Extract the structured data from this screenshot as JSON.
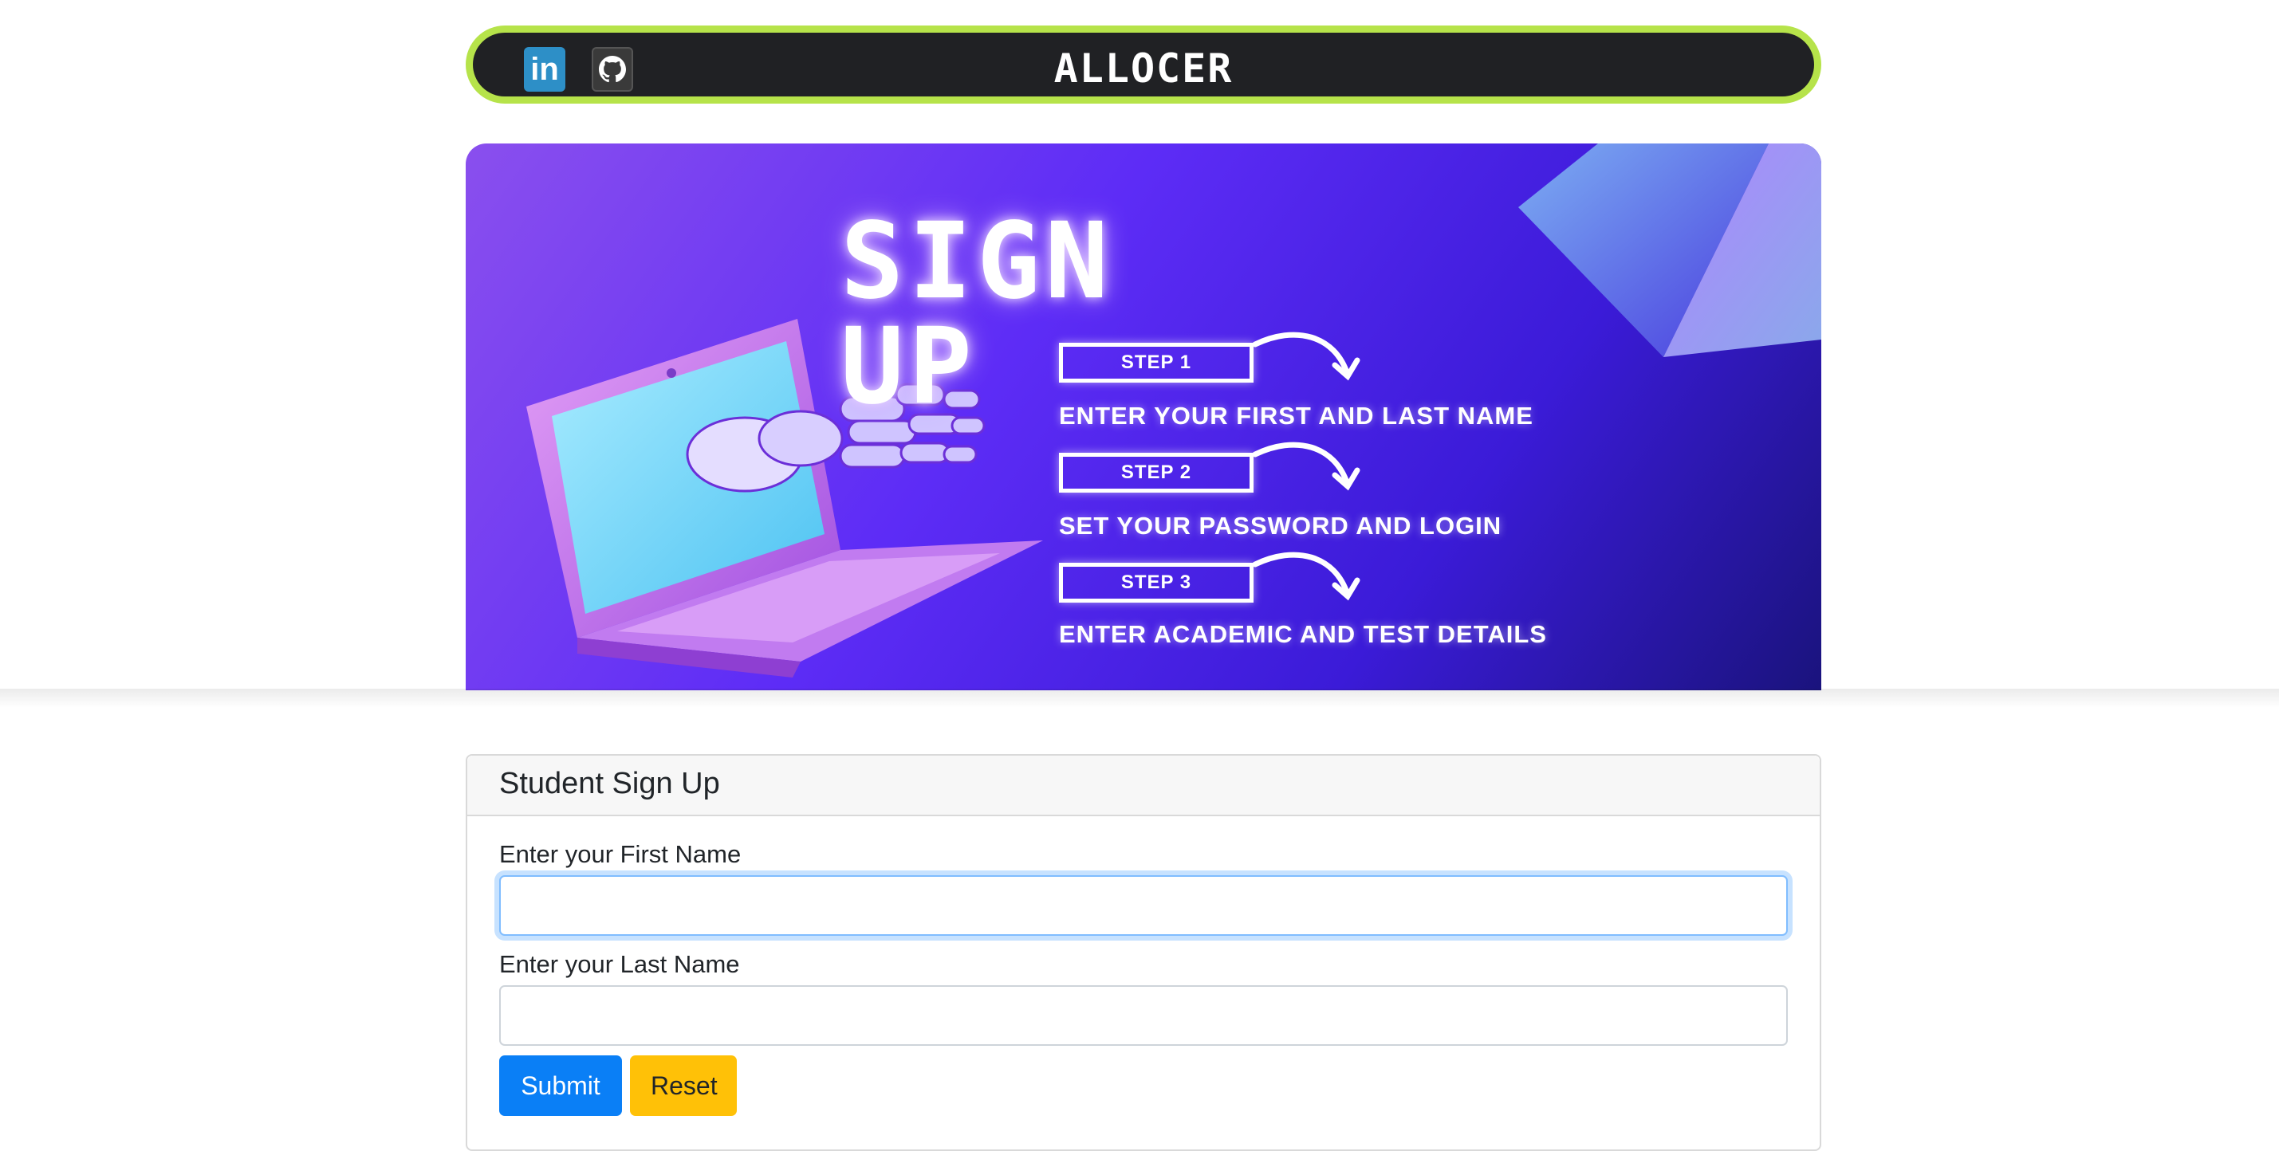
{
  "navbar": {
    "brand": "ALLOCER",
    "social": [
      {
        "name": "linkedin",
        "label": "in",
        "icon": "linkedin-icon"
      },
      {
        "name": "github",
        "icon": "github-icon"
      }
    ]
  },
  "banner": {
    "title": "SIGN UP",
    "steps": [
      {
        "label": "STEP 1",
        "text": "ENTER YOUR FIRST AND LAST NAME"
      },
      {
        "label": "STEP 2",
        "text": "SET YOUR PASSWORD AND LOGIN"
      },
      {
        "label": "STEP 3",
        "text": "ENTER ACADEMIC AND TEST DETAILS"
      }
    ]
  },
  "form": {
    "header": "Student Sign Up",
    "first_name_label": "Enter your First Name",
    "first_name_value": "",
    "last_name_label": "Enter your Last Name",
    "last_name_value": "",
    "submit_label": "Submit",
    "reset_label": "Reset"
  },
  "colors": {
    "nav_border": "#b6e34a",
    "nav_bg": "#202124",
    "submit": "#0a7ff6",
    "reset": "#ffc107"
  }
}
